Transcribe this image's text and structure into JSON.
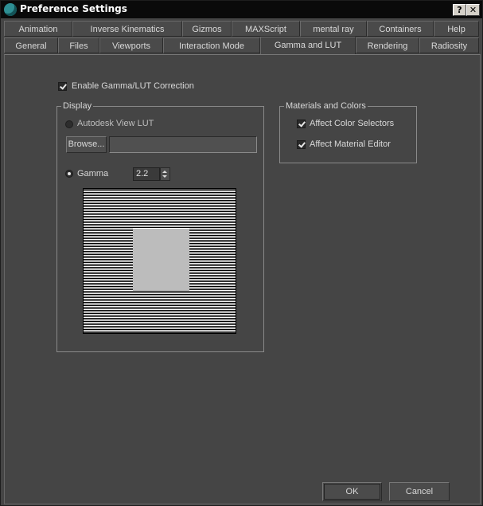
{
  "window": {
    "title": "Preference Settings",
    "help_glyph": "?",
    "close_glyph": "✕"
  },
  "tabs_row1": [
    "Animation",
    "Inverse Kinematics",
    "Gizmos",
    "MAXScript",
    "mental ray",
    "Containers",
    "Help"
  ],
  "tabs_row2": [
    "General",
    "Files",
    "Viewports",
    "Interaction Mode",
    "Gamma and LUT",
    "Rendering",
    "Radiosity"
  ],
  "active_tab": "Gamma and LUT",
  "gamma_lut": {
    "enable_label": "Enable Gamma/LUT Correction",
    "enable_checked": true,
    "display": {
      "group_title": "Display",
      "lut_option_label": "Autodesk View LUT",
      "lut_selected": false,
      "browse_label": "Browse...",
      "lut_path_value": "",
      "gamma_option_label": "Gamma",
      "gamma_selected": true,
      "gamma_value": "2.2"
    },
    "materials": {
      "group_title": "Materials and Colors",
      "affect_color_selectors_label": "Affect Color Selectors",
      "affect_color_selectors_checked": true,
      "affect_material_editor_label": "Affect Material Editor",
      "affect_material_editor_checked": true
    }
  },
  "footer": {
    "ok_label": "OK",
    "cancel_label": "Cancel"
  }
}
